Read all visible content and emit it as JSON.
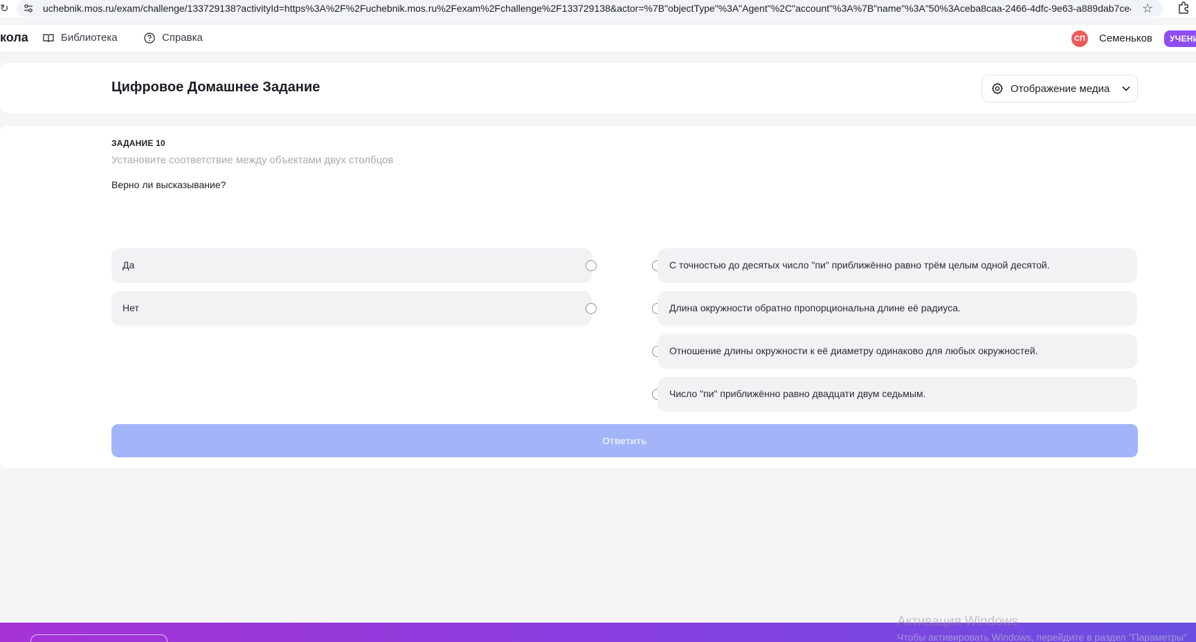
{
  "browser": {
    "url": "uchebnik.mos.ru/exam/challenge/133729138?activityId=https%3A%2F%2Fuchebnik.mos.ru%2Fexam%2Fchallenge%2F133729138&actor=%7B\"objectType\"%3A\"Agent\"%2C\"account\"%3A%7B\"name\"%3A\"50%3Aceba8caa-2466-4dfc-9e63-a889dab7ce44\"..."
  },
  "nav": {
    "brand": "кола",
    "library": "Библиотека",
    "help": "Справка",
    "avatar_initials": "СП",
    "username": "Семеньков",
    "role_badge": "УЧЕНИ"
  },
  "header": {
    "title": "Цифровое Домашнее Задание",
    "media_button": "Отображение медиа"
  },
  "task": {
    "number": "ЗАДАНИЕ 10",
    "instruction": "Установите соответствие между объектами двух столбцов",
    "question": "Верно ли высказывание?",
    "left_options": [
      "Да",
      "Нет"
    ],
    "right_options": [
      "С точностью до десятых число \"пи\" приближённо равно трём целым одной десятой.",
      "Длина окружности обратно пропорциональна длине её радиуса.",
      "Отношение длины окружности к её диаметру одинаково для любых окружностей.",
      "Число \"пи\" приближённо равно двадцати двум седьмым."
    ],
    "submit": "Ответить"
  },
  "watermark": {
    "title": "Активация Windows",
    "subtitle": "Чтобы активировать Windows, перейдите в раздел \"Параметры\""
  },
  "colors": {
    "accent": "#8f4df4",
    "submit_disabled": "#a3b4f9",
    "avatar": "#ee5b5b"
  }
}
